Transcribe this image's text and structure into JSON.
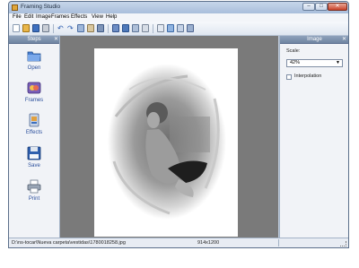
{
  "window": {
    "title": "Framing Studio",
    "min": "–",
    "max": "□",
    "close": "✕"
  },
  "menu": [
    "File",
    "Edit",
    "Image",
    "Frames",
    "Effects",
    "View",
    "Help"
  ],
  "toolbar": {
    "icons": [
      "new-icon",
      "open-icon",
      "save-icon",
      "print-icon",
      "undo-icon",
      "redo-icon",
      "copy-icon",
      "paste-icon",
      "crop-icon",
      "frame-icon",
      "frame-alt-icon",
      "effects-icon",
      "resize-icon",
      "rotate-icon",
      "adjust-icon",
      "text-icon"
    ]
  },
  "steps_panel": {
    "title": "Steps",
    "close": "✕",
    "items": [
      {
        "label": "Open",
        "icon": "folder-icon"
      },
      {
        "label": "Frames",
        "icon": "frames-icon"
      },
      {
        "label": "Effects",
        "icon": "effects-icon"
      },
      {
        "label": "Save",
        "icon": "floppy-disk-icon"
      },
      {
        "label": "Print",
        "icon": "printer-icon"
      }
    ]
  },
  "image_panel": {
    "title": "Image",
    "close": "✕",
    "scale_label": "Scale:",
    "scale_value": "42%",
    "interpolation_label": "Interpolation",
    "interpolation_checked": false
  },
  "status": {
    "path": "D:\\ns-tocar\\Nueva carpeta\\vestidas\\1780018258.jpg",
    "dimensions": "914x1200"
  },
  "colors": {
    "accent": "#2b4f9c",
    "canvas": "#7a7a7a",
    "panel_header": "#7a8fab"
  }
}
